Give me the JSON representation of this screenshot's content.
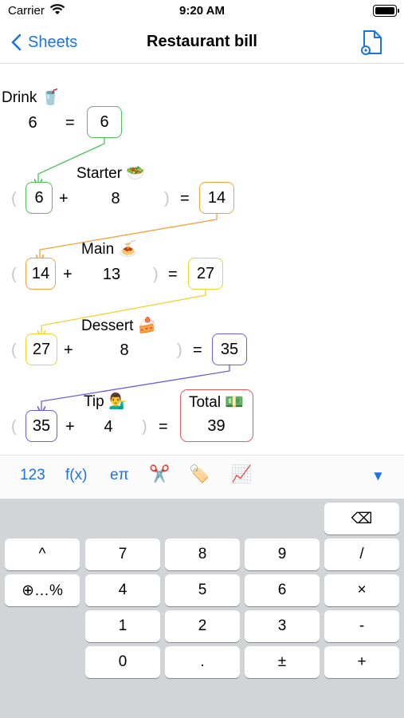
{
  "status": {
    "carrier": "Carrier",
    "time": "9:20 AM"
  },
  "nav": {
    "back_label": "Sheets",
    "title": "Restaurant bill"
  },
  "sheet": {
    "drink": {
      "label": "Drink 🥤",
      "input": "6",
      "eq": "=",
      "result": "6"
    },
    "starter": {
      "label": "Starter 🥗",
      "prev": "6",
      "plus": "+",
      "input": "8",
      "eq": "=",
      "result": "14"
    },
    "main": {
      "label": "Main 🍝",
      "prev": "14",
      "plus": "+",
      "input": "13",
      "eq": "=",
      "result": "27"
    },
    "dessert": {
      "label": "Dessert 🍰",
      "prev": "27",
      "plus": "+",
      "input": "8",
      "eq": "=",
      "result": "35"
    },
    "tip": {
      "label": "Tip 💁‍♂️",
      "prev": "35",
      "plus": "+",
      "input": "4",
      "eq": "="
    },
    "total": {
      "label": "Total 💵",
      "value": "39"
    },
    "colors": {
      "green": "#4cc25a",
      "orange": "#f2a23a",
      "yellow": "#f2d32b",
      "purple": "#6a5fd8",
      "red": "#e85a5a"
    }
  },
  "toolbar": {
    "numbers": "123",
    "functions": "f(x)",
    "constants": "eπ",
    "scissors": "✂️",
    "tag": "🏷️",
    "chart": "📈",
    "collapse": "▼"
  },
  "keyboard": {
    "backspace": "⌫",
    "rows": [
      [
        "^",
        "7",
        "8",
        "9",
        "/"
      ],
      [
        "⊕…%",
        "4",
        "5",
        "6",
        "×"
      ],
      [
        "",
        "1",
        "2",
        "3",
        "-"
      ],
      [
        "",
        "0",
        ".",
        "±",
        "+"
      ]
    ]
  }
}
